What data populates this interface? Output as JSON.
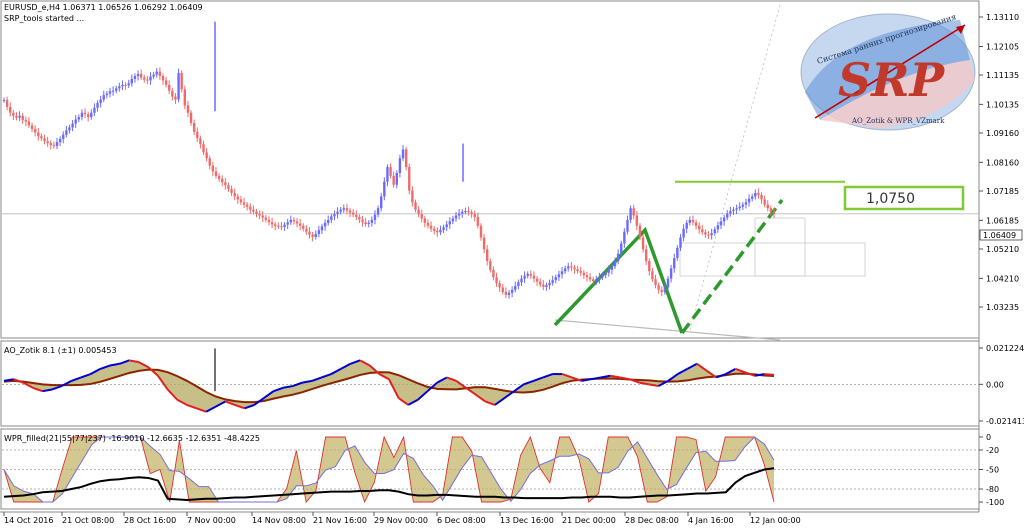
{
  "header": {
    "symbol_line": "EURUSD_e,H4  1.06371 1.06526 1.06292 1.06409",
    "status_line": "SRP_tools started ..."
  },
  "logo": {
    "big_text": "SRP",
    "arc_text": "Система ранних прогнозирования",
    "sub_text": "AO_Zotik & WPR_VZmark"
  },
  "price_label": {
    "text": "1,0750",
    "value": 1.075
  },
  "current_price": "1.06409",
  "colors": {
    "bull": "#6a6aff",
    "bear": "#f06a6a",
    "trend": "#2e9a2e",
    "level": "#80cc30",
    "ao_up": "#0000cc",
    "ao_down": "#e02020",
    "ao_fill": "#b5a860",
    "wpr_fill": "#c0b060"
  },
  "chart_data": [
    {
      "type": "candlestick",
      "title": "EURUSD_e,H4",
      "y_ticks": [
        "1.13110",
        "1.12105",
        "1.11135",
        "1.10135",
        "1.09160",
        "1.08160",
        "1.07185",
        "1.06185",
        "1.05210",
        "1.04210",
        "1.03235"
      ],
      "ylim": [
        1.03235,
        1.1311
      ],
      "grid": false,
      "candles_closes": [
        1.1028,
        1.1005,
        1.0985,
        1.0975,
        1.0968,
        1.0975,
        1.096,
        1.0955,
        1.0942,
        1.093,
        1.0918,
        1.0905,
        1.0898,
        1.0888,
        1.0882,
        1.0875,
        1.0872,
        1.0885,
        1.0896,
        1.091,
        1.0925,
        1.0935,
        1.0948,
        1.0962,
        1.097,
        1.0985,
        1.098,
        1.097,
        1.0985,
        1.1002,
        1.1018,
        1.103,
        1.1045,
        1.105,
        1.1058,
        1.106,
        1.1068,
        1.1075,
        1.108,
        1.1078,
        1.1085,
        1.11,
        1.111,
        1.1117,
        1.1105,
        1.1098,
        1.1095,
        1.1108,
        1.1115,
        1.1125,
        1.111,
        1.1095,
        1.108,
        1.106,
        1.104,
        1.103,
        1.112,
        1.1065,
        1.101,
        1.0985,
        1.095,
        1.092,
        1.0898,
        1.0878,
        1.085,
        1.083,
        1.0805,
        1.0785,
        1.077,
        1.076,
        1.0748,
        1.0738,
        1.0725,
        1.0712,
        1.07,
        1.069,
        1.068,
        1.0672,
        1.0665,
        1.0655,
        1.0648,
        1.064,
        1.0635,
        1.0628,
        1.062,
        1.0612,
        1.0605,
        1.06,
        1.0598,
        1.0596,
        1.0604,
        1.0612,
        1.062,
        1.0615,
        1.0608,
        1.06,
        1.059,
        1.058,
        1.057,
        1.0562,
        1.0572,
        1.0585,
        1.0598,
        1.061,
        1.062,
        1.0632,
        1.064,
        1.0648,
        1.0655,
        1.066,
        1.0652,
        1.0645,
        1.0638,
        1.063,
        1.0622,
        1.0612,
        1.0606,
        1.061,
        1.062,
        1.0638,
        1.066,
        1.07,
        1.075,
        1.08,
        1.077,
        1.074,
        1.078,
        1.083,
        1.086,
        1.08,
        1.072,
        1.068,
        1.0655,
        1.064,
        1.0625,
        1.061,
        1.06,
        1.059,
        1.0583,
        1.0578,
        1.0586,
        1.0595,
        1.0605,
        1.0615,
        1.0625,
        1.0635,
        1.0642,
        1.0648,
        1.065,
        1.0646,
        1.064,
        1.063,
        1.06,
        1.056,
        1.052,
        1.048,
        1.045,
        1.0425,
        1.0405,
        1.039,
        1.0375,
        1.0365,
        1.0372,
        1.0382,
        1.0395,
        1.0408,
        1.042,
        1.043,
        1.0436,
        1.043,
        1.042,
        1.041,
        1.04,
        1.0392,
        1.0398,
        1.0405,
        1.0415,
        1.0425,
        1.0435,
        1.0445,
        1.0455,
        1.0462,
        1.0458,
        1.0452,
        1.0446,
        1.044,
        1.0432,
        1.0425,
        1.0418,
        1.0412,
        1.0418,
        1.0425,
        1.0432,
        1.044,
        1.045,
        1.0462,
        1.048,
        1.0505,
        1.054,
        1.058,
        1.062,
        1.066,
        1.0635,
        1.06,
        1.056,
        1.052,
        1.048,
        1.0445,
        1.0418,
        1.0398,
        1.0382,
        1.0375,
        1.039,
        1.042,
        1.0455,
        1.049,
        1.0525,
        1.056,
        1.059,
        1.061,
        1.062,
        1.0612,
        1.06,
        1.0588,
        1.0578,
        1.057,
        1.0568,
        1.0575,
        1.0588,
        1.0602,
        1.0615,
        1.0628,
        1.0642,
        1.065,
        1.0655,
        1.066,
        1.0665,
        1.0672,
        1.068,
        1.0692,
        1.07,
        1.0712,
        1.0705,
        1.069,
        1.0672,
        1.066,
        1.0648,
        1.0641
      ]
    },
    {
      "type": "line",
      "title": "AO_Zotik 8.1 (±1) 0.005453",
      "y_ticks": [
        "0.021224",
        "0.00",
        "-0.021413"
      ],
      "ylim": [
        -0.021413,
        0.021224
      ],
      "series": [
        {
          "name": "AO_Zotik",
          "values": [
            0.002,
            0.003,
            0.001,
            -0.002,
            -0.004,
            -0.003,
            -0.001,
            0.002,
            0.004,
            0.006,
            0.009,
            0.011,
            0.012,
            0.014,
            0.013,
            0.01,
            0.005,
            -0.003,
            -0.009,
            -0.012,
            -0.014,
            -0.016,
            -0.013,
            -0.01,
            -0.012,
            -0.014,
            -0.012,
            -0.008,
            -0.004,
            -0.002,
            -0.001,
            0.001,
            0.002,
            0.004,
            0.006,
            0.009,
            0.012,
            0.014,
            0.011,
            0.006,
            0.003,
            -0.008,
            -0.012,
            -0.009,
            -0.004,
            0.001,
            0.004,
            0.002,
            -0.002,
            -0.006,
            -0.01,
            -0.012,
            -0.008,
            -0.004,
            0.0,
            0.002,
            0.004,
            0.006,
            0.006,
            0.004,
            0.002,
            0.003,
            0.004,
            0.005,
            0.004,
            0.003,
            0.001,
            0.0,
            -0.001,
            0.002,
            0.006,
            0.009,
            0.012,
            0.008,
            0.004,
            0.006,
            0.009,
            0.007,
            0.005,
            0.006,
            0.0055
          ]
        }
      ]
    },
    {
      "type": "line",
      "title": "WPR_filled(21|55|77|237) -16.9010 -12.6635 -12.6351 -48.4225",
      "y_ticks": [
        "0",
        "-20",
        "-50",
        "-80",
        "-100"
      ],
      "ylim": [
        -100,
        0
      ],
      "series": [
        {
          "name": "WPR 237",
          "values": [
            -92,
            -91,
            -90,
            -88,
            -85,
            -84,
            -83,
            -80,
            -77,
            -72,
            -68,
            -66,
            -65,
            -63,
            -62,
            -63,
            -67,
            -95,
            -96,
            -97,
            -96,
            -95,
            -95,
            -94,
            -93,
            -93,
            -92,
            -91,
            -90,
            -89,
            -88,
            -87,
            -86,
            -85,
            -84,
            -84,
            -84,
            -83,
            -83,
            -82,
            -82,
            -84,
            -88,
            -90,
            -90,
            -89,
            -89,
            -90,
            -91,
            -92,
            -92,
            -92,
            -93,
            -93,
            -94,
            -94,
            -94,
            -94,
            -94,
            -93,
            -93,
            -92,
            -92,
            -92,
            -93,
            -93,
            -92,
            -91,
            -90,
            -90,
            -89,
            -88,
            -87,
            -87,
            -86,
            -85,
            -70,
            -60,
            -55,
            -50,
            -48
          ]
        }
      ]
    }
  ],
  "x_ticks": [
    "14 Oct 2016",
    "21 Oct 08:00",
    "28 Oct 16:00",
    "7 Nov 00:00",
    "14 Nov 08:00",
    "21 Nov 16:00",
    "29 Nov 00:00",
    "6 Dec 08:00",
    "13 Dec 16:00",
    "21 Dec 00:00",
    "28 Dec 08:00",
    "4 Jan 16:00",
    "12 Jan 00:00"
  ]
}
